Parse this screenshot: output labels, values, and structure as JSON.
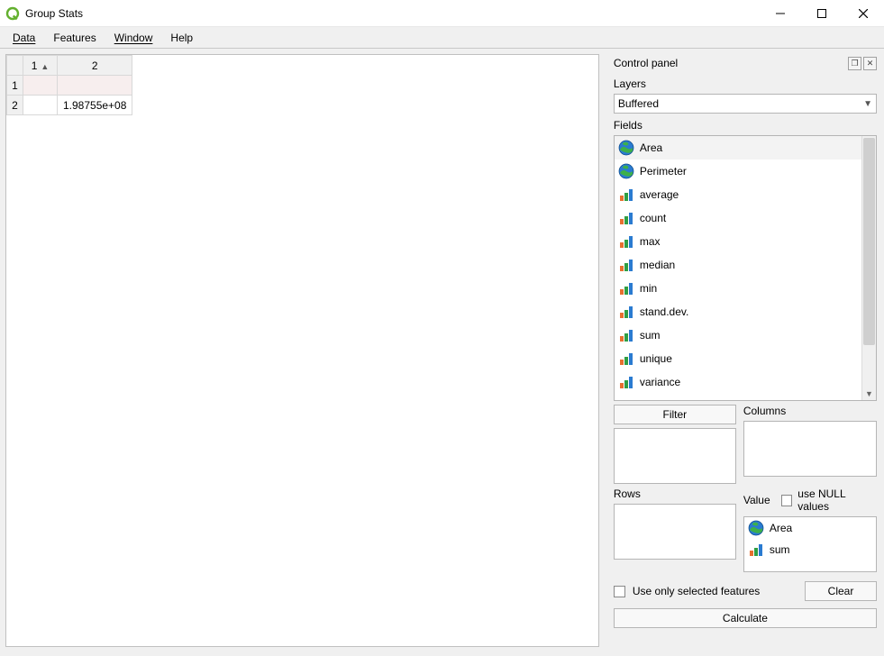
{
  "window": {
    "title": "Group Stats"
  },
  "menubar": {
    "data": "Data",
    "features": "Features",
    "window": "Window",
    "help": "Help"
  },
  "table": {
    "cols": [
      "1",
      "2"
    ],
    "rows": [
      {
        "hdr": "1",
        "cells": [
          "",
          ""
        ]
      },
      {
        "hdr": "2",
        "cells": [
          "",
          "1.98755e+08"
        ]
      }
    ]
  },
  "panel": {
    "title": "Control panel",
    "layers_label": "Layers",
    "layers_value": "Buffered",
    "fields_label": "Fields",
    "fields": [
      {
        "icon": "globe",
        "label": "Area"
      },
      {
        "icon": "globe",
        "label": "Perimeter"
      },
      {
        "icon": "bars",
        "label": "average"
      },
      {
        "icon": "bars",
        "label": "count"
      },
      {
        "icon": "bars",
        "label": "max"
      },
      {
        "icon": "bars",
        "label": "median"
      },
      {
        "icon": "bars",
        "label": "min"
      },
      {
        "icon": "bars",
        "label": "stand.dev."
      },
      {
        "icon": "bars",
        "label": "sum"
      },
      {
        "icon": "bars",
        "label": "unique"
      },
      {
        "icon": "bars",
        "label": "variance"
      }
    ],
    "filter_btn": "Filter",
    "columns_label": "Columns",
    "rows_label": "Rows",
    "value_label": "Value",
    "use_null_label": "use NULL values",
    "value_items": [
      {
        "icon": "globe",
        "label": "Area"
      },
      {
        "icon": "bars",
        "label": "sum"
      }
    ],
    "use_selected_label": "Use only selected features",
    "clear_btn": "Clear",
    "calculate_btn": "Calculate"
  }
}
